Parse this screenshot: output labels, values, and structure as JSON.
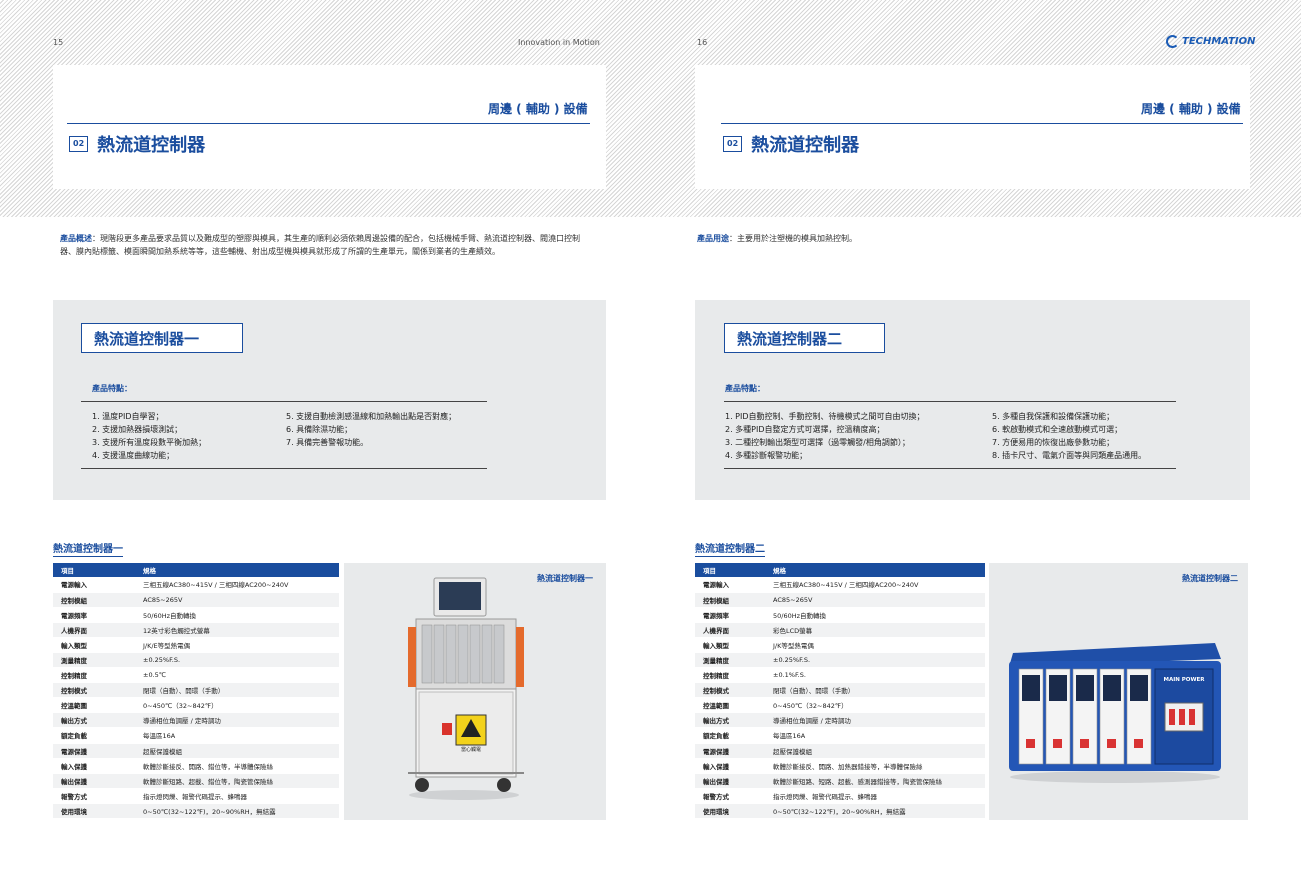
{
  "header": {
    "left_page_num": "15",
    "running_title": "Innovation in Motion",
    "right_page_num": "16",
    "brand": "TECHMATION"
  },
  "left": {
    "section": "周邊 ( 輔助 ) 設備",
    "number": "02",
    "title": "熱流道控制器",
    "intro_lead": "產品概述",
    "intro_text": "：現階段更多產品要求品質以及難成型的塑膠與模具，其生產的順利必須依賴周邊設備的配合，包括機械手臂、熱流道控制器、閥澆口控制器、膜內貼標籤、模面瞬間加熱系統等等，這些輔機、射出成型機與模具就形成了所謂的生產單元，關係到業者的生產績效。",
    "box_title": "熱流道控制器一",
    "features_label": "產品特點：",
    "features_col1": [
      "1. 溫度PID自學習；",
      "2. 支援加熱器損壞測試；",
      "3. 支援所有溫度段數平衡加熱；",
      "4. 支援溫度曲線功能；"
    ],
    "features_col2": [
      "5. 支援自動檢測感溫線和加熱輸出點是否對應；",
      "6. 具備除濕功能；",
      "7. 具備完善警報功能。"
    ],
    "table_heading": "熱流道控制器一",
    "table_header": [
      "項目",
      "規格"
    ],
    "table_rows": [
      [
        "電源輸入",
        "三相五線AC380~415V / 三相四線AC200~240V"
      ],
      [
        "控制模組",
        "AC85~265V"
      ],
      [
        "電源頻率",
        "50/60Hz自動轉換"
      ],
      [
        "人機界面",
        "12英寸彩色觸控式螢幕"
      ],
      [
        "輸入類型",
        "J/K/E等型熱電偶"
      ],
      [
        "測量精度",
        "±0.25%F.S."
      ],
      [
        "控制精度",
        "±0.5℃"
      ],
      [
        "控制模式",
        "閉環（自動）、開環（手動）"
      ],
      [
        "控溫範圍",
        "0~450℃（32~842℉）"
      ],
      [
        "輸出方式",
        "導通相位角調壓 / 定時調功"
      ],
      [
        "額定負載",
        "每溫區16A"
      ],
      [
        "電源保護",
        "超壓保護模組"
      ],
      [
        "輸入保護",
        "軟體診斷接反、開路、錯位等，半導體保險絲"
      ],
      [
        "輸出保護",
        "軟體診斷短路、超載、錯位等，陶瓷管保險絲"
      ],
      [
        "報警方式",
        "指示燈閃爍、報警代碼提示、蜂鳴器"
      ],
      [
        "使用環境",
        "0~50℃(32~122℉)，20~90%RH，無結露"
      ]
    ],
    "image_label": "熱流道控制器一",
    "image_warning_text": "當心觸電"
  },
  "right": {
    "section": "周邊 ( 輔助 ) 設備",
    "number": "02",
    "title": "熱流道控制器",
    "intro_lead": "產品用途",
    "intro_text": "：主要用於注塑機的模具加熱控制。",
    "box_title": "熱流道控制器二",
    "features_label": "產品特點：",
    "features_col1": [
      "1. PID自動控制、手動控制、待機模式之間可自由切換；",
      "2. 多種PID自整定方式可選擇，控溫精度高；",
      "3. 二種控制輸出類型可選擇（過零觸發/相角調節）；",
      "4. 多種診斷報警功能；"
    ],
    "features_col2": [
      "5. 多種自我保護和設備保護功能；",
      "6. 軟啟動模式和全速啟動模式可選；",
      "7. 方便易用的恢復出廠參數功能；",
      "8. 插卡尺寸、電氣介面等與同類產品通用。"
    ],
    "table_heading": "熱流道控制器二",
    "table_header": [
      "項目",
      "規格"
    ],
    "table_rows": [
      [
        "電源輸入",
        "三相五線AC380~415V / 三相四線AC200~240V"
      ],
      [
        "控制模組",
        "AC85~265V"
      ],
      [
        "電源頻率",
        "50/60Hz自動轉換"
      ],
      [
        "人機界面",
        "彩色LCD螢幕"
      ],
      [
        "輸入類型",
        "J/K等型熱電偶"
      ],
      [
        "測量精度",
        "±0.25%F.S."
      ],
      [
        "控制精度",
        "±0.1%F.S."
      ],
      [
        "控制模式",
        "閉環（自動）、開環（手動）"
      ],
      [
        "控溫範圍",
        "0~450℃（32~842℉）"
      ],
      [
        "輸出方式",
        "導通相位角調壓 / 定時調功"
      ],
      [
        "額定負載",
        "每溫區16A"
      ],
      [
        "電源保護",
        "超壓保護模組"
      ],
      [
        "輸入保護",
        "軟體診斷接反、開路、加熱器錯接等，半導體保險絲"
      ],
      [
        "輸出保護",
        "軟體診斷短路、短路、超載、感測器錯接等，陶瓷管保險絲"
      ],
      [
        "報警方式",
        "指示燈閃爍、報警代碼提示、蜂鳴器"
      ],
      [
        "使用環境",
        "0~50℃(32~122℉)，20~90%RH，無結露"
      ]
    ],
    "image_label": "熱流道控制器二",
    "image_panel_text": "MAIN POWER"
  }
}
